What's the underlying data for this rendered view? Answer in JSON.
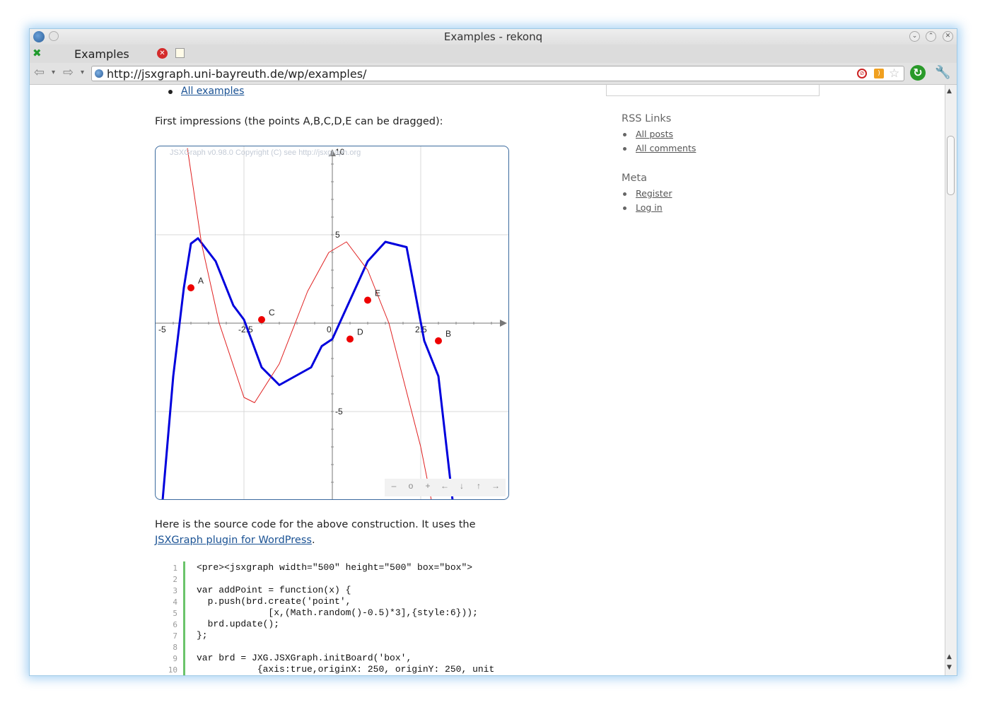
{
  "window": {
    "title": "Examples - rekonq"
  },
  "tab": {
    "label": "Examples"
  },
  "address": {
    "url": "http://jsxgraph.uni-bayreuth.de/wp/examples/"
  },
  "page": {
    "top_link": "All examples",
    "intro": "First impressions (the points A,B,C,D,E can be dragged):",
    "after_text_before": "Here is the source code for the above construction. It uses the ",
    "after_link": "JSXGraph plugin for WordPress",
    "after_text_end": "."
  },
  "board": {
    "copyright": "JSXGraph v0.98.0 Copyright (C) see http://jsxgraph.org",
    "x_ticks": [
      "-5",
      "-2.5",
      "0",
      "2.5"
    ],
    "y_ticks": [
      "10",
      "5",
      "-5"
    ],
    "points": [
      "A",
      "B",
      "C",
      "D",
      "E"
    ],
    "nav_buttons": [
      "–",
      "o",
      "+",
      "←",
      "↓",
      "↑",
      "→"
    ]
  },
  "code": {
    "line_numbers": [
      "1",
      "2",
      "3",
      "4",
      "5",
      "6",
      "7",
      "8",
      "9",
      "10"
    ],
    "lines": [
      "<pre><jsxgraph width=\"500\" height=\"500\" box=\"box\">",
      "",
      "var addPoint = function(x) {",
      "  p.push(brd.create('point',",
      "             [x,(Math.random()-0.5)*3],{style:6}));",
      "  brd.update();",
      "};",
      "",
      "var brd = JXG.JSXGraph.initBoard('box',",
      "           {axis:true,originX: 250, originY: 250, unit"
    ]
  },
  "sidebar": {
    "rss_heading": "RSS Links",
    "rss_items": [
      "All posts",
      "All comments"
    ],
    "meta_heading": "Meta",
    "meta_items": [
      "Register",
      "Log in"
    ]
  },
  "colors": {
    "accent_blue": "#0000dd",
    "curve_red": "#e02020",
    "point": "#ee0000",
    "link": "#1a5294"
  },
  "chart_data": {
    "type": "line",
    "title": "",
    "xlabel": "",
    "ylabel": "",
    "xlim": [
      -5,
      5
    ],
    "ylim": [
      -10,
      10
    ],
    "grid": true,
    "series": [
      {
        "color": "#0000dd",
        "x": [
          -4.8,
          -4.5,
          -4.2,
          -4,
          -3.8,
          -3.3,
          -2.8,
          -2.5,
          -2,
          -1.5,
          -0.6,
          -0.3,
          0,
          0.5,
          1,
          1.5,
          2.1,
          2.6,
          3,
          3.4
        ],
        "y": [
          -10,
          -3,
          2,
          4.5,
          4.8,
          3.5,
          1,
          0.2,
          -2.5,
          -3.5,
          -2.5,
          -1.3,
          -0.9,
          1.3,
          3.5,
          4.6,
          4.3,
          -1,
          -3,
          -10
        ]
      },
      {
        "color": "#e02020",
        "x": [
          -4.1,
          -3.7,
          -3.2,
          -2.5,
          -2.2,
          -1.5,
          -0.7,
          -0.1,
          0.4,
          1,
          1.6,
          2.5,
          2.8
        ],
        "y": [
          9.9,
          4.5,
          0,
          -4.2,
          -4.5,
          -2.3,
          1.8,
          4,
          4.6,
          3,
          0,
          -7,
          -10
        ]
      }
    ]
  }
}
